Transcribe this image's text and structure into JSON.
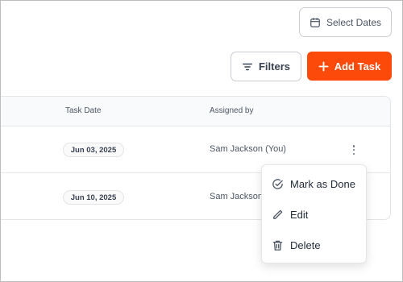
{
  "toolbar": {
    "select_dates_label": "Select Dates",
    "filters_label": "Filters",
    "add_task_label": "Add Task"
  },
  "table": {
    "columns": [
      "Task Date",
      "Assigned by"
    ],
    "rows": [
      {
        "task_date": "Jun 03, 2025",
        "assigned_by": "Sam Jackson (You)"
      },
      {
        "task_date": "Jun 10, 2025",
        "assigned_by": "Sam Jackson"
      }
    ]
  },
  "row_menu": {
    "items": [
      {
        "label": "Mark as Done",
        "icon": "check-circle-icon"
      },
      {
        "label": "Edit",
        "icon": "pencil-icon"
      },
      {
        "label": "Delete",
        "icon": "trash-icon"
      }
    ]
  },
  "colors": {
    "accent": "#fb4a0a",
    "border": "#c9ccd1"
  }
}
